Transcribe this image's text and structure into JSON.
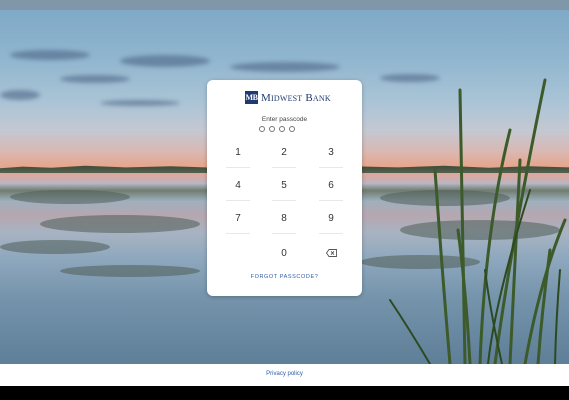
{
  "bank": {
    "logo_mark": "MB",
    "name": "Midwest Bank"
  },
  "passcode": {
    "prompt": "Enter passcode",
    "digits_entered": 0,
    "digits_total": 4
  },
  "keypad": {
    "k1": "1",
    "k2": "2",
    "k3": "3",
    "k4": "4",
    "k5": "5",
    "k6": "6",
    "k7": "7",
    "k8": "8",
    "k9": "9",
    "k0": "0",
    "backspace_icon": "backspace-icon"
  },
  "forgot_label": "FORGOT PASSCODE?",
  "footer": {
    "privacy_label": "Privacy policy"
  },
  "colors": {
    "brand": "#1f3a6e",
    "link": "#2e5ca8",
    "card": "#ffffff"
  }
}
